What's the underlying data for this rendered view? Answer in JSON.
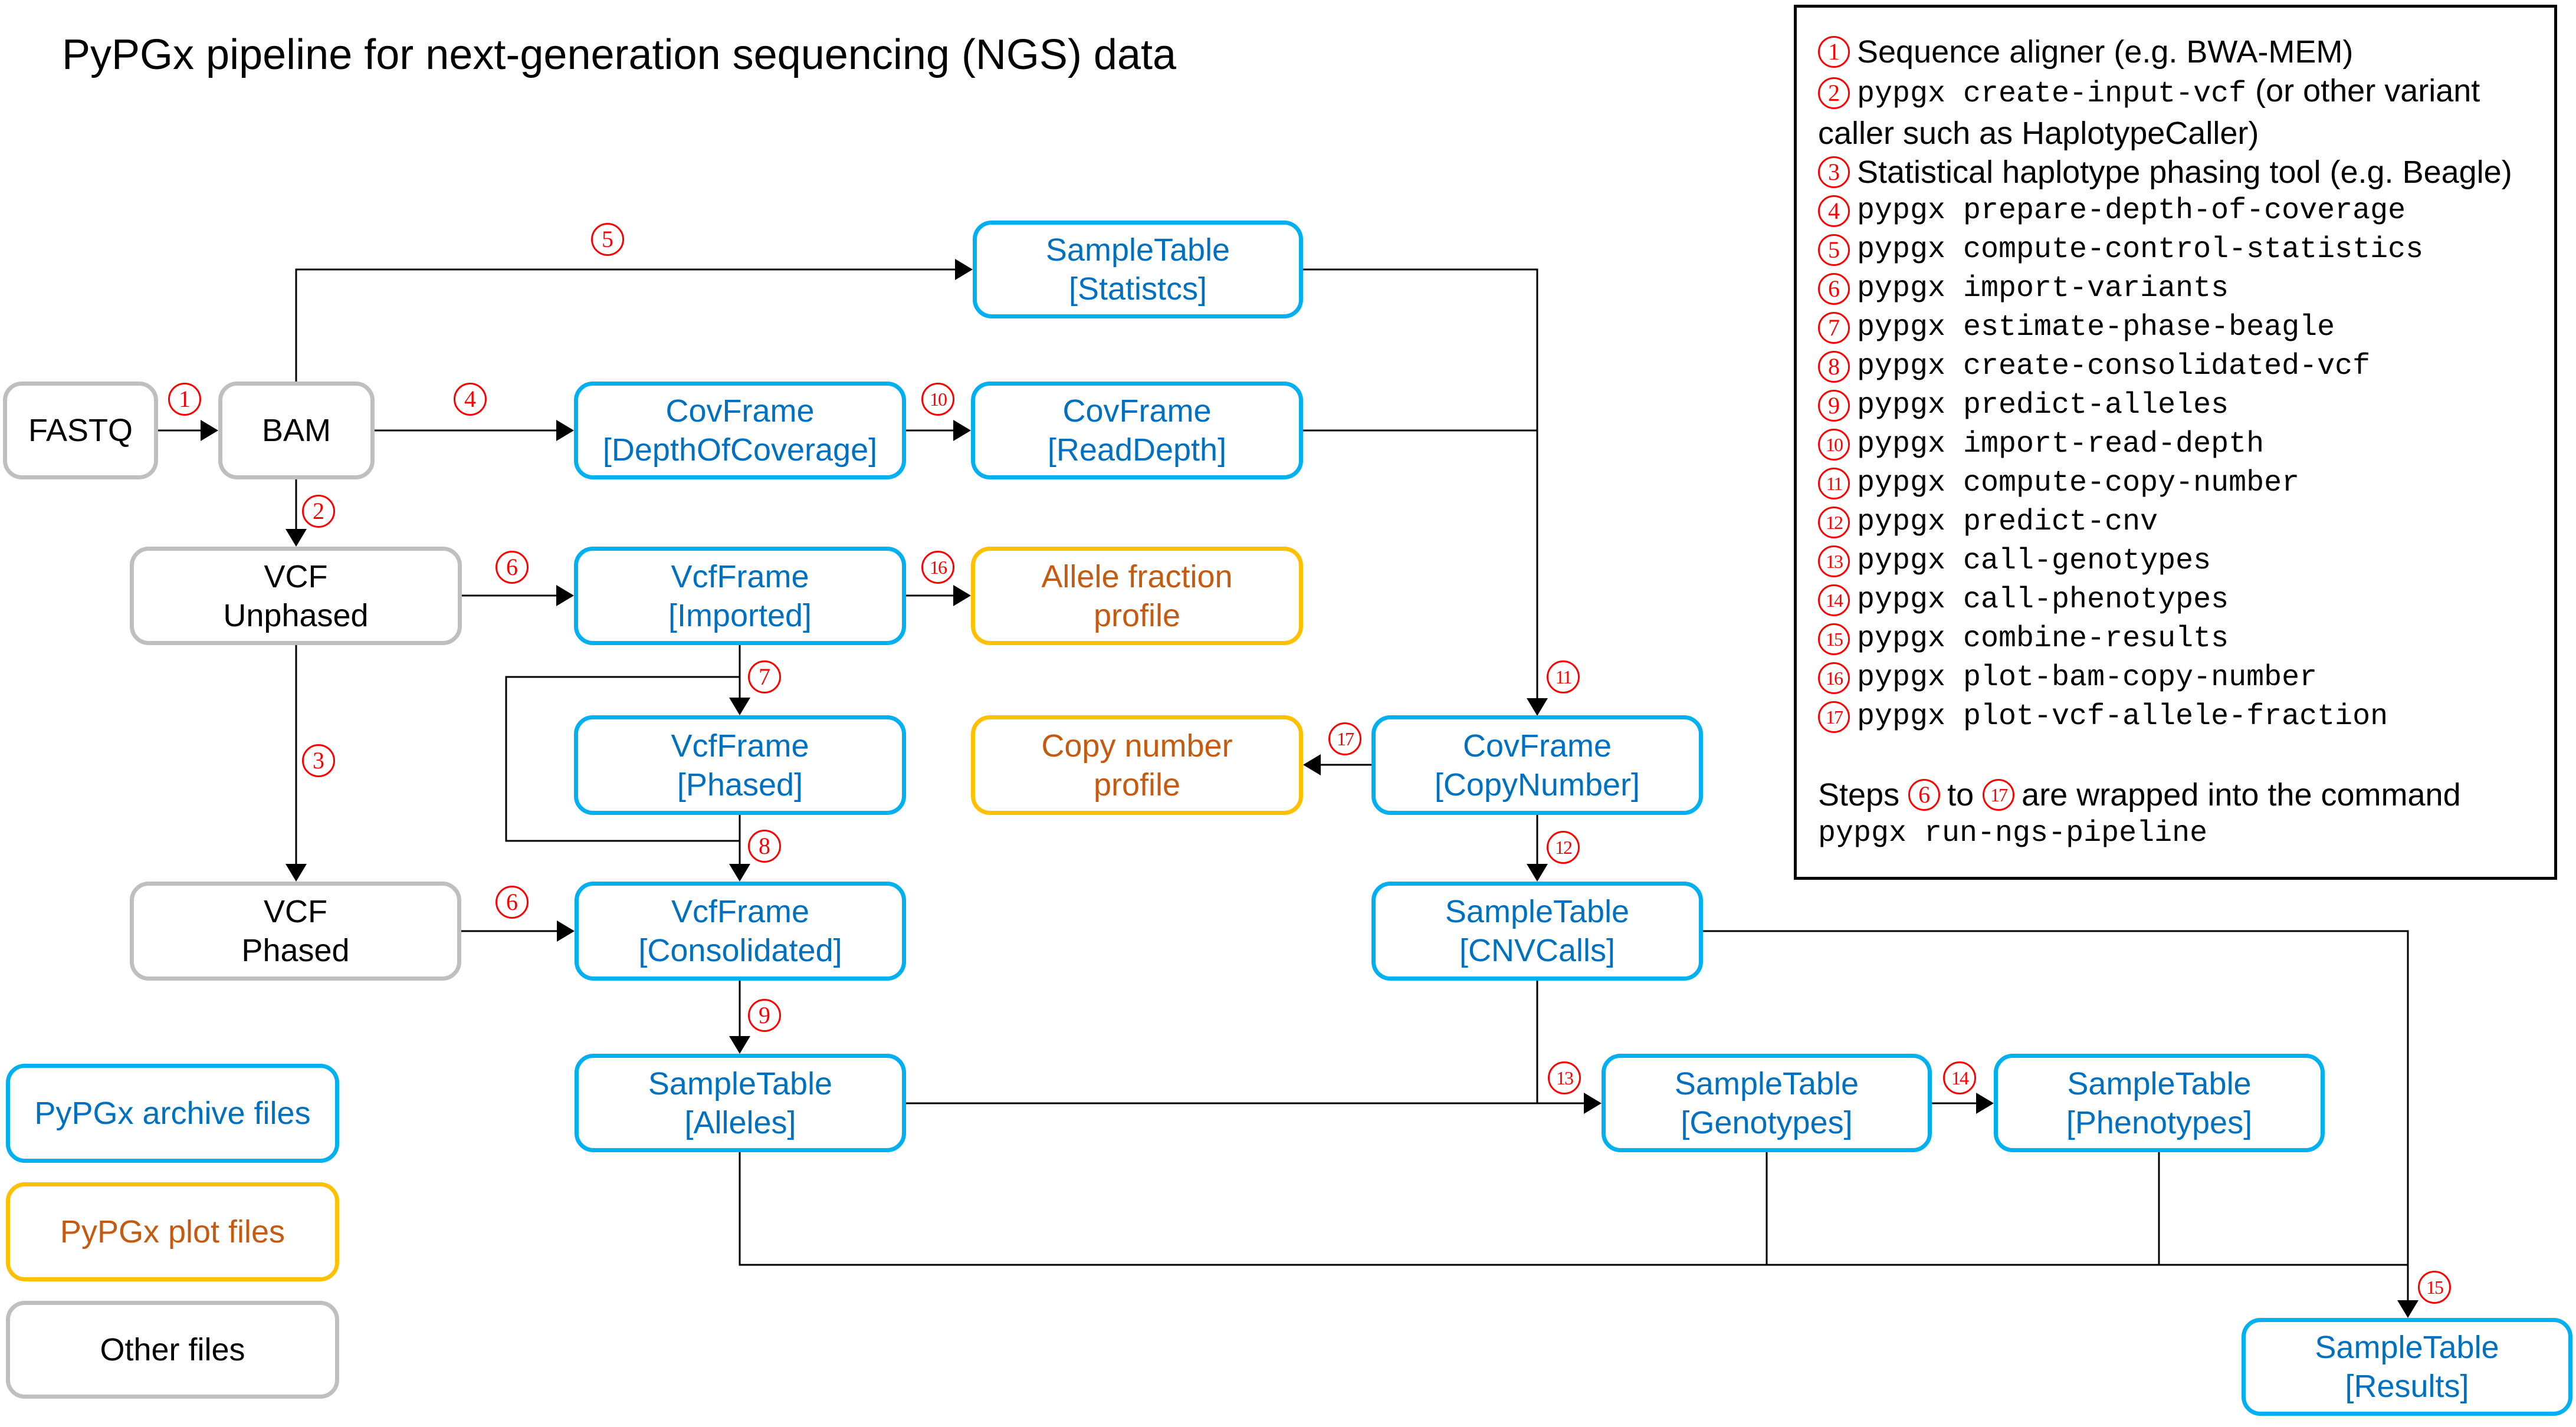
{
  "title": "PyPGx pipeline for next-generation sequencing (NGS) data",
  "colors": {
    "archive_border": "#00b0f0",
    "archive_text": "#0070c0",
    "plot_border": "#ffc000",
    "plot_text": "#c55a11",
    "other_border": "#bfbfbf",
    "step_marker": "#ff0000",
    "connector": "#000000"
  },
  "nodes": {
    "fastq": {
      "line1": "FASTQ",
      "type": "other"
    },
    "bam": {
      "line1": "BAM",
      "type": "other"
    },
    "vcf_unphased": {
      "line1": "VCF",
      "line2": "Unphased",
      "type": "other"
    },
    "vcf_phased": {
      "line1": "VCF",
      "line2": "Phased",
      "type": "other"
    },
    "sampletable_statistics": {
      "line1": "SampleTable",
      "line2": "[Statistcs]",
      "type": "archive"
    },
    "covframe_depthofcoverage": {
      "line1": "CovFrame",
      "line2": "[DepthOfCoverage]",
      "type": "archive"
    },
    "covframe_readdepth": {
      "line1": "CovFrame",
      "line2": "[ReadDepth]",
      "type": "archive"
    },
    "vcfframe_imported": {
      "line1": "VcfFrame",
      "line2": "[Imported]",
      "type": "archive"
    },
    "allele_fraction_profile": {
      "line1": "Allele fraction",
      "line2": "profile",
      "type": "plot"
    },
    "vcfframe_phased": {
      "line1": "VcfFrame",
      "line2": "[Phased]",
      "type": "archive"
    },
    "copy_number_profile": {
      "line1": "Copy number",
      "line2": "profile",
      "type": "plot"
    },
    "covframe_copynumber": {
      "line1": "CovFrame",
      "line2": "[CopyNumber]",
      "type": "archive"
    },
    "vcfframe_consolidated": {
      "line1": "VcfFrame",
      "line2": "[Consolidated]",
      "type": "archive"
    },
    "sampletable_cnvcalls": {
      "line1": "SampleTable",
      "line2": "[CNVCalls]",
      "type": "archive"
    },
    "sampletable_alleles": {
      "line1": "SampleTable",
      "line2": "[Alleles]",
      "type": "archive"
    },
    "sampletable_genotypes": {
      "line1": "SampleTable",
      "line2": "[Genotypes]",
      "type": "archive"
    },
    "sampletable_phenotypes": {
      "line1": "SampleTable",
      "line2": "[Phenotypes]",
      "type": "archive"
    },
    "sampletable_results": {
      "line1": "SampleTable",
      "line2": "[Results]",
      "type": "archive"
    }
  },
  "file_key": [
    {
      "label": "PyPGx archive files",
      "type": "archive"
    },
    {
      "label": "PyPGx plot files",
      "type": "plot"
    },
    {
      "label": "Other files",
      "type": "other"
    }
  ],
  "edge_steps": {
    "fastq_to_bam": "1",
    "bam_to_vcf_unphased": "2",
    "vcf_unphased_to_vcf_phased": "3",
    "bam_to_depthofcoverage": "4",
    "bam_to_statistics": "5",
    "vcf_unphased_to_imported": "6",
    "vcf_phased_to_consolidated": "6",
    "imported_to_phased": "7",
    "phased_to_consolidated": "8",
    "consolidated_to_alleles": "9",
    "depthofcoverage_to_readdepth": "10",
    "to_copynumber": "11",
    "copynumber_to_cnvcalls": "12",
    "to_genotypes": "13",
    "genotypes_to_phenotypes": "14",
    "to_results": "15",
    "imported_to_allele_fraction": "16",
    "copynumber_to_copy_number_profile": "17"
  },
  "legend": {
    "steps": [
      {
        "num": "1",
        "text": "Sequence aligner (e.g. BWA-MEM)",
        "mono": ""
      },
      {
        "num": "2",
        "mono": "pypgx create-input-vcf",
        "text": " (or other variant caller such as HaplotypeCaller)"
      },
      {
        "num": "3",
        "text": "Statistical haplotype phasing tool (e.g. Beagle)",
        "mono": ""
      },
      {
        "num": "4",
        "mono": "pypgx prepare-depth-of-coverage",
        "text": ""
      },
      {
        "num": "5",
        "mono": "pypgx compute-control-statistics",
        "text": ""
      },
      {
        "num": "6",
        "mono": "pypgx import-variants",
        "text": ""
      },
      {
        "num": "7",
        "mono": "pypgx estimate-phase-beagle",
        "text": ""
      },
      {
        "num": "8",
        "mono": "pypgx create-consolidated-vcf",
        "text": ""
      },
      {
        "num": "9",
        "mono": "pypgx predict-alleles",
        "text": ""
      },
      {
        "num": "10",
        "mono": "pypgx import-read-depth",
        "text": ""
      },
      {
        "num": "11",
        "mono": "pypgx compute-copy-number",
        "text": ""
      },
      {
        "num": "12",
        "mono": "pypgx predict-cnv",
        "text": ""
      },
      {
        "num": "13",
        "mono": "pypgx call-genotypes",
        "text": ""
      },
      {
        "num": "14",
        "mono": "pypgx call-phenotypes",
        "text": ""
      },
      {
        "num": "15",
        "mono": "pypgx combine-results",
        "text": ""
      },
      {
        "num": "16",
        "mono": "pypgx plot-bam-copy-number",
        "text": ""
      },
      {
        "num": "17",
        "mono": "pypgx plot-vcf-allele-fraction",
        "text": ""
      }
    ],
    "note": {
      "prefix": "Steps",
      "from_step": "6",
      "middle": "to",
      "to_step": "17",
      "suffix": "are wrapped into the command",
      "command": "pypgx run-ngs-pipeline"
    }
  }
}
